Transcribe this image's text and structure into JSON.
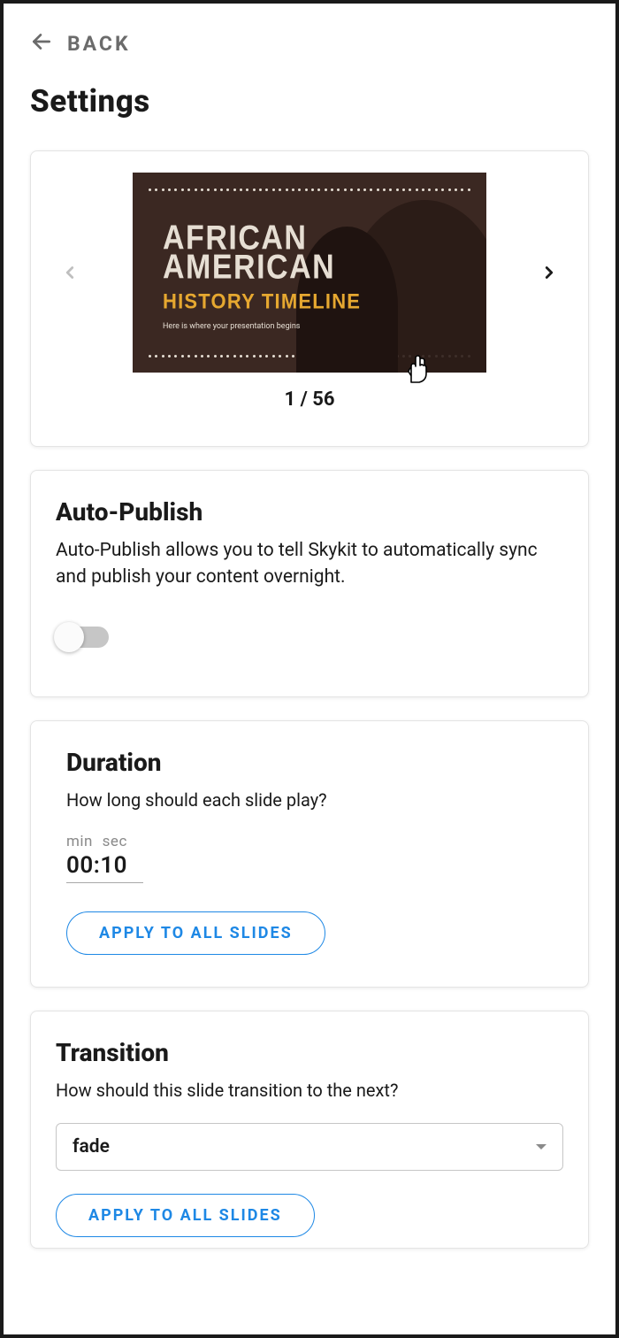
{
  "back_label": "BACK",
  "page_title": "Settings",
  "slide": {
    "title_line1": "AFRICAN",
    "title_line2": "AMERICAN",
    "title_line3": "HISTORY TIMELINE",
    "subtitle": "Here is where your presentation begins",
    "counter": "1 / 56"
  },
  "auto_publish": {
    "title": "Auto-Publish",
    "description": "Auto-Publish allows you to tell Skykit to automatically sync and publish your content overnight.",
    "enabled": false
  },
  "duration": {
    "title": "Duration",
    "description": "How long should each slide play?",
    "unit_min": "min",
    "unit_sec": "sec",
    "minutes": "00",
    "seconds": "10",
    "apply_label": "APPLY TO ALL SLIDES"
  },
  "transition": {
    "title": "Transition",
    "description": "How should this slide transition to the next?",
    "value": "fade",
    "apply_label": "APPLY TO ALL SLIDES"
  }
}
